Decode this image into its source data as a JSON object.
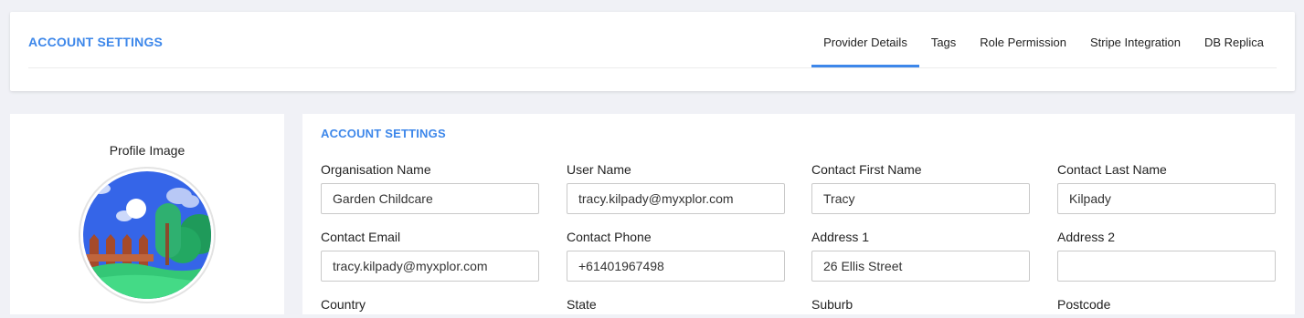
{
  "header": {
    "title": "ACCOUNT SETTINGS",
    "tabs": [
      {
        "label": "Provider Details",
        "active": true
      },
      {
        "label": "Tags"
      },
      {
        "label": "Role Permission"
      },
      {
        "label": "Stripe Integration"
      },
      {
        "label": "DB Replica"
      }
    ]
  },
  "profile": {
    "label": "Profile Image",
    "image_icon": "garden-illustration"
  },
  "account": {
    "title": "ACCOUNT SETTINGS",
    "fields": [
      {
        "label": "Organisation Name",
        "value": "Garden Childcare"
      },
      {
        "label": "User Name",
        "value": "tracy.kilpady@myxplor.com"
      },
      {
        "label": "Contact First Name",
        "value": "Tracy"
      },
      {
        "label": "Contact Last Name",
        "value": "Kilpady"
      },
      {
        "label": "Contact Email",
        "value": "tracy.kilpady@myxplor.com"
      },
      {
        "label": "Contact Phone",
        "value": "+61401967498"
      },
      {
        "label": "Address 1",
        "value": "26 Ellis Street"
      },
      {
        "label": "Address 2",
        "value": ""
      },
      {
        "label": "Country",
        "value": ""
      },
      {
        "label": "State",
        "value": ""
      },
      {
        "label": "Suburb",
        "value": ""
      },
      {
        "label": "Postcode",
        "value": ""
      }
    ]
  },
  "colors": {
    "accent": "#3d87ea",
    "page_bg": "#f0f1f6"
  }
}
